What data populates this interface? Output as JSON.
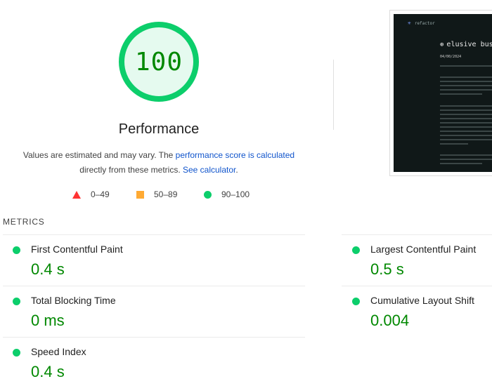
{
  "gauge": {
    "score": "100",
    "score_fraction": 1.0,
    "title": "Performance",
    "ring_color": "#0cce6b",
    "fill_color": "#e5faef",
    "text_color": "#008800"
  },
  "description": {
    "text_1": "Values are estimated and may vary. The ",
    "link_1": "performance score is calculated",
    "text_2": " directly from these metrics. ",
    "link_2": "See calculator",
    "text_3": "."
  },
  "legend": {
    "fail": {
      "label": "0–49",
      "icon": "red-triangle-icon",
      "color": "#ff3333"
    },
    "average": {
      "label": "50–89",
      "icon": "orange-square-icon",
      "color": "#ffaa33"
    },
    "pass": {
      "label": "90–100",
      "icon": "green-circle-icon",
      "color": "#0cce6b"
    }
  },
  "screenshot": {
    "brand": "refactor",
    "title": "elusive bus",
    "date": "04/00/2024"
  },
  "metrics": {
    "header": "METRICS",
    "items": [
      {
        "name": "First Contentful Paint",
        "value": "0.4 s",
        "status": "pass"
      },
      {
        "name": "Largest Contentful Paint",
        "value": "0.5 s",
        "status": "pass"
      },
      {
        "name": "Total Blocking Time",
        "value": "0 ms",
        "status": "pass"
      },
      {
        "name": "Cumulative Layout Shift",
        "value": "0.004",
        "status": "pass"
      },
      {
        "name": "Speed Index",
        "value": "0.4 s",
        "status": "pass"
      }
    ]
  }
}
